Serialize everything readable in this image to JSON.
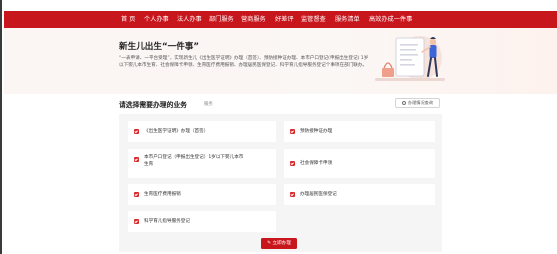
{
  "nav": {
    "items": [
      {
        "label": "首 页"
      },
      {
        "label": "个人办事"
      },
      {
        "label": "法人办事"
      },
      {
        "label": "部门服务"
      },
      {
        "label": "营商服务"
      },
      {
        "label": "好差评"
      },
      {
        "label": "监管督查"
      },
      {
        "label": "服务清单"
      },
      {
        "label": "高效办成一件事"
      }
    ]
  },
  "hero": {
    "title": "新生儿出生“一件事”",
    "description": "“一表申请、一平台受理”，实现新生儿《出生医学证明》办理（首签）、预防接种证办理、本市户口登记(申报出生登记) 1岁以下婴儿本市生育、社会保障卡申领、生育医疗费用报销、办理居民医保登记、科学育儿指导服务登记个事项在部门联办。"
  },
  "section": {
    "title": "请选择需要办理的业务",
    "subtitle": "服务",
    "check_button": "办理情况查询"
  },
  "business_items": [
    {
      "label": "《出生医学证明》办理（首签）",
      "checked": true
    },
    {
      "label": "预防接种证办理",
      "checked": true
    },
    {
      "label": "本市户口登记（申报出生登记）1岁以下婴儿本市生育",
      "checked": true
    },
    {
      "label": "社会保障卡申领",
      "checked": true
    },
    {
      "label": "生育医疗费用报销",
      "checked": true
    },
    {
      "label": "办理居民医保登记",
      "checked": true
    },
    {
      "label": "科学育儿指导服务登记",
      "checked": true
    }
  ],
  "submit": {
    "label": "立即办理"
  },
  "colors": {
    "brand_red": "#c8161d",
    "checkbox_red": "#d72b2b",
    "panel_bg": "#f5f5f5"
  }
}
